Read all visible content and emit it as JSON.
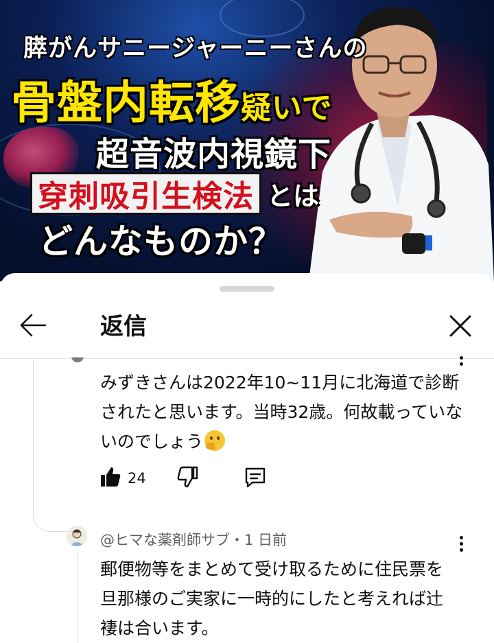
{
  "thumbnail": {
    "line1": "膵がんサニージャーニーさんの",
    "line2_big": "骨盤内転移",
    "line2_small": "疑いで",
    "line3": "超音波内視鏡下",
    "line4_box": "穿刺吸引生検法",
    "line4_tail": "とは",
    "line5": "どんなものか？"
  },
  "header": {
    "title": "返信",
    "back_icon": "arrow-left-icon",
    "close_icon": "close-icon"
  },
  "comment": {
    "text": "みずきさんは2022年10~11月に北海道で診断されたと思います。当時32歳。何故載っていないのでしょう",
    "emoji": "thinking-face-emoji",
    "likes": "24"
  },
  "reply": {
    "author_meta": "@ヒマな薬剤師サブ・1 日前",
    "text": "郵便物等をまとめて受け取るために住民票を旦那様のご実家に一時的にしたと考えれば辻褄は合います。"
  },
  "colors": {
    "thumb_yellow": "#ffe600",
    "thumb_red": "#d4101e",
    "text_primary": "#0f0f0f",
    "text_secondary": "#606060"
  }
}
